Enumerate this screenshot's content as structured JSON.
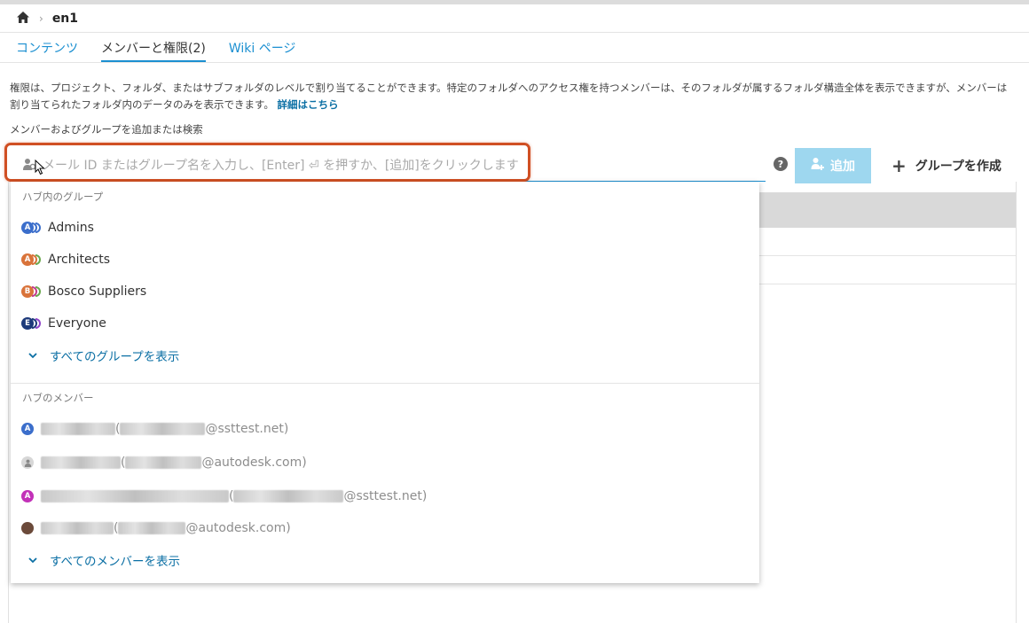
{
  "breadcrumb": {
    "home_icon": "home-icon",
    "separator": "›",
    "current": "en1"
  },
  "tabs": [
    {
      "label": "コンテンツ",
      "active": false
    },
    {
      "label": "メンバーと権限(2)",
      "active": true
    },
    {
      "label": "Wiki ページ",
      "active": false
    }
  ],
  "description": {
    "text": "権限は、プロジェクト、フォルダ、またはサブフォルダのレベルで割り当てることができます。特定のフォルダへのアクセス権を持つメンバーは、そのフォルダが属するフォルダ構造全体を表示できますが、メンバーは割り当てられたフォルダ内のデータのみを表示できます。",
    "link": "詳細はこちら"
  },
  "search": {
    "label": "メンバーおよびグループを追加または検索",
    "placeholder": "メール ID またはグループ名を入力し、[Enter] ⏎ を押すか、[追加]をクリックします",
    "value": ""
  },
  "actions": {
    "help": "?",
    "add_label": "追加",
    "create_group_label": "グループを作成"
  },
  "dropdown": {
    "groups_title": "ハブ内のグループ",
    "groups": [
      {
        "name": "Admins",
        "initial": "A",
        "color": "#3b6ecb"
      },
      {
        "name": "Architects",
        "initial": "A",
        "color": "#d9733a"
      },
      {
        "name": "Bosco Suppliers",
        "initial": "B",
        "color": "#d9733a"
      },
      {
        "name": "Everyone",
        "initial": "E",
        "color": "#1d3a7a"
      }
    ],
    "show_all_groups": "すべてのグループを表示",
    "members_title": "ハブのメンバー",
    "members": [
      {
        "initial": "A",
        "color": "#3b6ecb",
        "domain": "@ssttest.net)"
      },
      {
        "initial": "",
        "color": "#d7d7d7",
        "domain": "@autodesk.com)"
      },
      {
        "initial": "A",
        "color": "#c231b8",
        "domain": "@ssttest.net)"
      },
      {
        "initial": "",
        "color": "#6b4a3a",
        "domain": "@autodesk.com)"
      }
    ],
    "show_all_members": "すべてのメンバーを表示"
  }
}
